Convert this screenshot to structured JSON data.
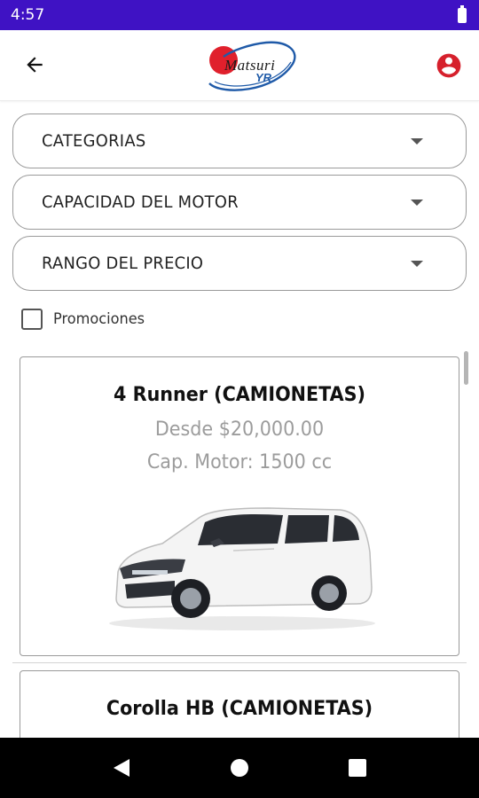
{
  "status_bar": {
    "time": "4:57"
  },
  "app_bar": {
    "logo_main": "Matsuri",
    "logo_sub": "YR"
  },
  "filters": [
    {
      "label": "CATEGORIAS"
    },
    {
      "label": "CAPACIDAD DEL MOTOR"
    },
    {
      "label": "RANGO DEL PRECIO"
    }
  ],
  "promo": {
    "label": "Promociones",
    "checked": false
  },
  "cars": [
    {
      "title": "4 Runner (CAMIONETAS)",
      "price": "Desde $20,000.00",
      "motor": "Cap. Motor: 1500 cc"
    },
    {
      "title": "Corolla HB (CAMIONETAS)"
    }
  ],
  "colors": {
    "status_bar": "#3f12c4",
    "accent_red": "#d6202c",
    "brand_blue": "#1f5aa8"
  }
}
